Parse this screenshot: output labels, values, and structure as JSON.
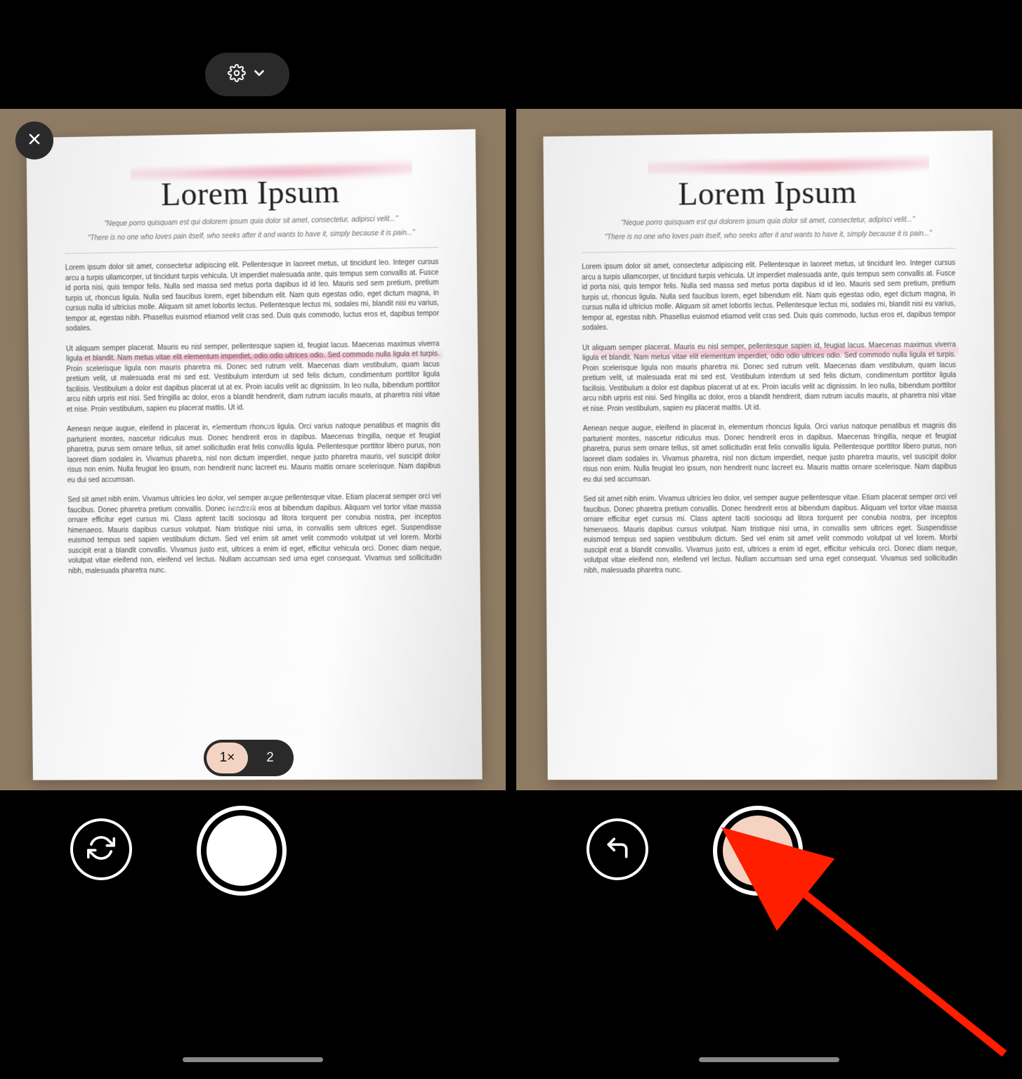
{
  "document": {
    "title": "Lorem Ipsum",
    "subtitle_line1": "\"Neque porro quisquam est qui dolorem ipsum quia dolor sit amet, consectetur, adipisci velit...\"",
    "subtitle_line2": "\"There is no one who loves pain itself, who seeks after it and wants to have it, simply because it is pain...\"",
    "paragraphs": [
      "Lorem ipsum dolor sit amet, consectetur adipiscing elit. Pellentesque in laoreet metus, ut tincidunt leo. Integer cursus arcu a turpis ullamcorper, ut tincidunt turpis vehicula. Ut imperdiet malesuada ante, quis tempus sem convallis at. Fusce id porta nisi, quis tempor felis. Nulla sed massa sed metus porta dapibus id id leo. Mauris sed sem pretium, pretium turpis ut, rhoncus ligula. Nulla sed faucibus lorem, eget bibendum elit. Nam quis egestas odio, eget dictum magna, in cursus nulla id ultricius molle. Aliquam sit amet lobortis lectus. Pellentesque lectus mi, sodales mi, blandit nisi eu varius, tempor at, egestas nibh. Phasellus euismod etiamod velit cras sed. Duis quis commodo, luctus eros et, dapibus tempor sodales.",
      "Ut aliquam semper placerat. Mauris eu nisl semper, pellentesque sapien id, feugiat lacus. Maecenas maximus viverra ligula et blandit. Nam metus vitae elit elementum imperdiet, odio odio ultrices odio. Sed commodo nulla ligula et turpis. Proin scelerisque ligula non mauris pharetra mi. Donec sed rutrum velit. Maecenas diam vestibulum, quam lacus pretium velit, ut malesuada erat mi sed est. Vestibulum interdum ut sed felis dictum, condimentum porttitor ligula facilisis. Vestibulum a dolor est dapibus placerat ut at ex. Proin iaculis velit ac dignissim. In leo nulla, bibendum porttitor arcu nibh urpris est nisi. Sed fringilla ac dolor, eros a blandit hendrerit, diam rutrum iaculis mauris, at pharetra nisi vitae et nise. Proin vestibulum, sapien eu placerat mattis. Ut id.",
      "Aenean neque augue, eleifend in placerat in, elementum rhoncus ligula. Orci varius natoque penatibus et magnis dis parturient montes, nascetur ridiculus mus. Donec hendrerit eros in dapibus. Maecenas fringilla, neque et feugiat pharetra, purus sem ornare tellus, sit amet sollicitudin erat felis convallis ligula. Pellentesque porttitor libero purus, non laoreet diam sodales in. Vivamus pharetra, nisl non dictum imperdiet, neque justo pharetra mauris, vel suscipit dolor risus non enim. Nulla feugiat leo ipsum, non hendrerit nunc lacreet eu. Mauris mattis ornare scelerisque. Nam dapibus eu dui sed accumsan.",
      "Sed sit amet nibh enim. Vivamus ultricies leo dolor, vel semper augue pellentesque vitae. Etiam placerat semper orci vel faucibus. Donec pharetra pretium convallis. Donec hendrerit eros at bibendum dapibus. Aliquam vel tortor vitae massa ornare efficitur eget cursus mi. Class aptent taciti sociosqu ad litora torquent per conubia nostra, per inceptos himenaeos. Mauris dapibus cursus volutpat. Nam tristique nisi urna, in convallis sem ultrices eget. Suspendisse euismod tempus sed sapien vestibulum dictum. Sed vel enim sit amet velit commodo volutpat ut vel lorem. Morbi suscipit erat a blandit convallis. Vivamus justo est, ultrices a enim id eget, efficitur vehicula orci. Donec diam neque, volutpat vitae eleifend non, eleifend vel lectus. Nullam accumsan sed urna eget consequat. Vivamus sed sollicitudin nibh, malesuada pharetra nunc."
    ]
  },
  "zoom": {
    "option1": "1×",
    "option2": "2",
    "active_index": 0
  },
  "icons": {
    "settings": "settings-icon",
    "chevron": "chevron-down-icon",
    "close": "close-icon",
    "retake": "refresh-icon",
    "back": "undo-icon",
    "confirm": "check-icon"
  },
  "annotation": {
    "kind": "arrow",
    "color": "#ff1e00"
  },
  "colors": {
    "accent_peach": "#f4d3c2",
    "desk": "#8e7b63",
    "panel": "#2a2a2a"
  }
}
